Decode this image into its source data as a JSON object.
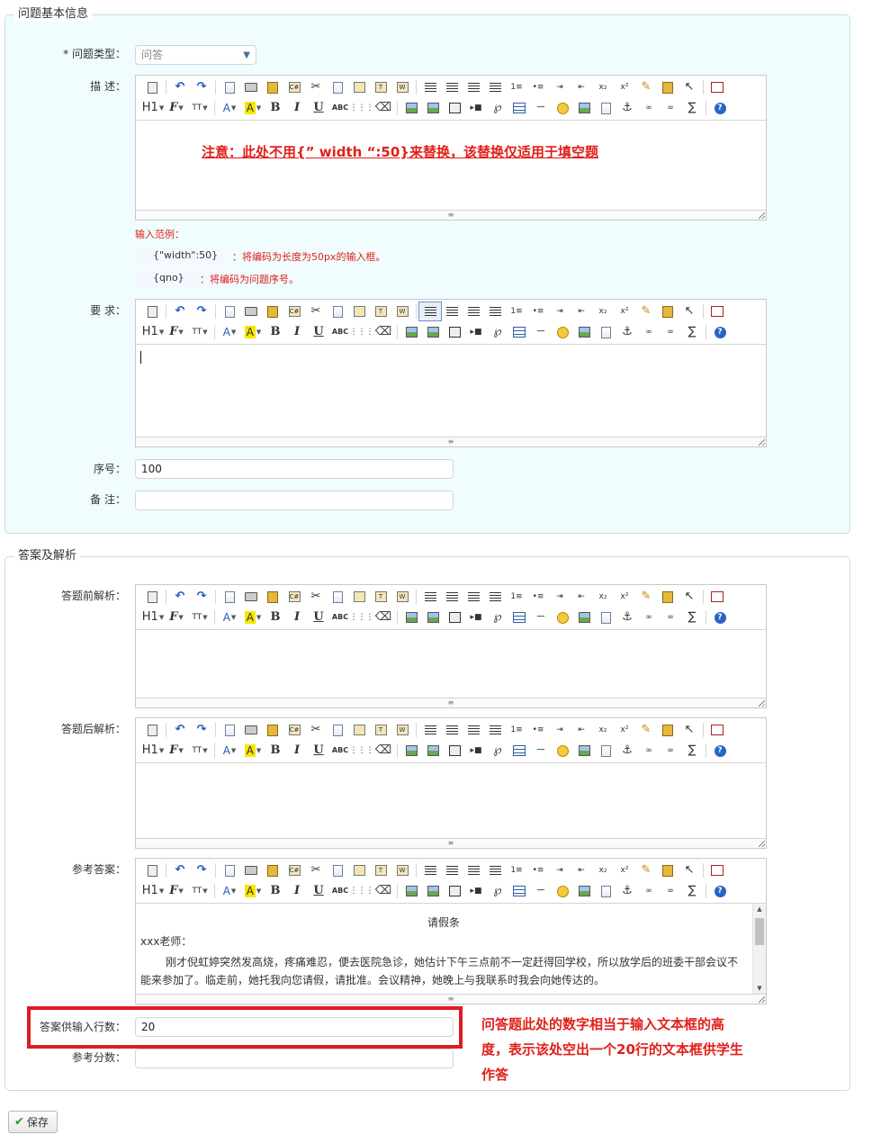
{
  "section1": {
    "legend": "问题基本信息",
    "type_label": "* 问题类型：",
    "type_value": "问答",
    "desc_label": "描  述：",
    "desc_notice": "注意：此处不用{” width “:50}来替换，该替换仅适用于填空题",
    "hint_title": "输入范例：",
    "hints": [
      {
        "code": "{\"width\":50}",
        "desc": "：将编码为长度为50px的输入框。"
      },
      {
        "code": "{qno}",
        "desc": "：将编码为问题序号。"
      }
    ],
    "req_label": "要  求：",
    "seq_label": "序号：",
    "seq_value": "100",
    "remark_label": "备  注："
  },
  "section2": {
    "legend": "答案及解析",
    "pre_label": "答题前解析：",
    "post_label": "答题后解析：",
    "ref_label": "参考答案：",
    "ref_doc": {
      "title": "请假条",
      "salutation": "xxx老师：",
      "body_line1": "刚才倪虹婷突然发高烧，疼痛难忍，便去医院急诊，她估计下午三点前不一定赶得回学校，所以放学后的班委干部会议不",
      "body_line2": "能来参加了。临走前，她托我向您请假，请批准。会议精神，她晚上与我联系时我会向她传达的。"
    },
    "rows_label": "答案供输入行数：",
    "rows_value": "20",
    "score_label": "参考分数："
  },
  "annotation": {
    "line1": "问答题此处的数字相当于输入文本框的高",
    "line2": "度，表示该处空出一个20行的文本框供学生",
    "line3": "作答"
  },
  "save_label": "保存",
  "toolbar": {
    "h1": "H1",
    "font_family": "F",
    "font_size": "TT",
    "font_color": "A",
    "highlight": "A",
    "bold": "B",
    "italic": "I",
    "underline": "U",
    "strike": "ABC",
    "sub": "x₂",
    "sup": "x²",
    "sigma": "∑",
    "help": "?"
  },
  "colors": {
    "accent_red": "#e0201b",
    "panel_bg": "#f0fcfd",
    "border": "#c9dde0"
  }
}
